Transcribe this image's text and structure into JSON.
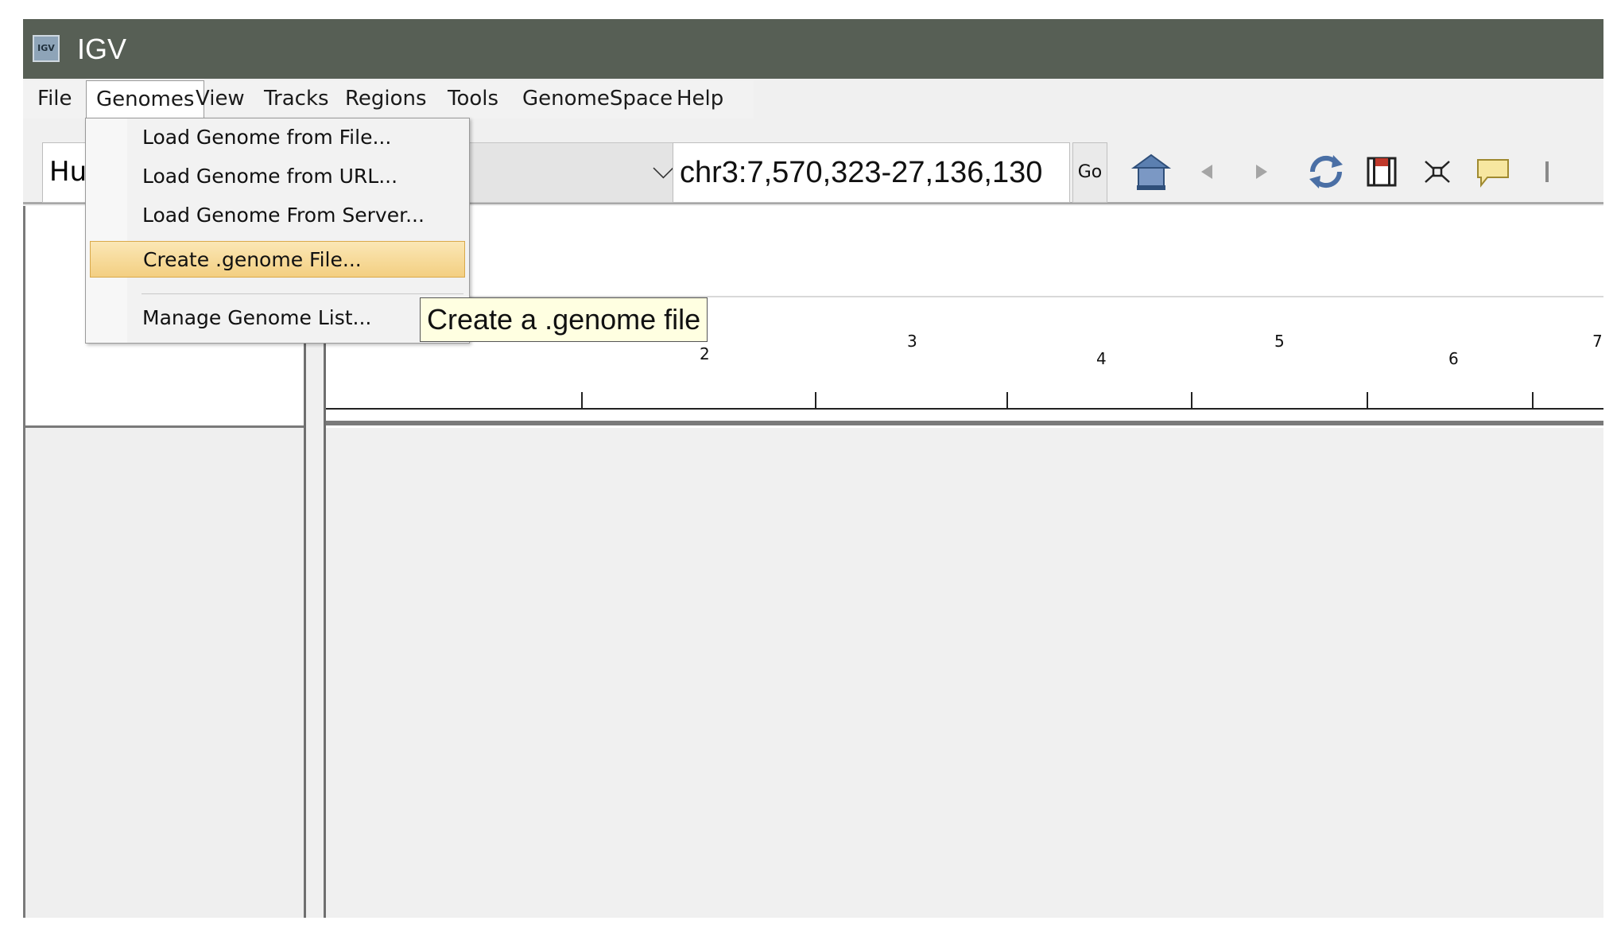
{
  "window": {
    "title": "IGV",
    "app_icon_text": "IGV"
  },
  "menubar": {
    "items": [
      {
        "label": "File"
      },
      {
        "label": "Genomes"
      },
      {
        "label": "View"
      },
      {
        "label": "Tracks"
      },
      {
        "label": "Regions"
      },
      {
        "label": "Tools"
      },
      {
        "label": "GenomeSpace"
      },
      {
        "label": "Help"
      }
    ],
    "active": "Genomes"
  },
  "toolbar": {
    "genome_value": "Hu",
    "chromosome_value": "",
    "locus_value": "chr3:7,570,323-27,136,130",
    "go_label": "Go",
    "icons": [
      "home-icon",
      "back-icon",
      "forward-icon",
      "refresh-icon",
      "region-icon",
      "resize-icon",
      "popup-info-icon",
      "ruler-icon"
    ]
  },
  "genomes_menu": {
    "items": [
      {
        "label": "Load Genome from File..."
      },
      {
        "label": "Load Genome from URL..."
      },
      {
        "label": "Load Genome From Server..."
      },
      {
        "label": "Create .genome File..."
      },
      {
        "label": "Manage Genome List..."
      }
    ],
    "highlighted": "Create .genome File..."
  },
  "tooltip": {
    "text": "Create a .genome file"
  },
  "ruler": {
    "labels": [
      "2",
      "3",
      "4",
      "5",
      "6",
      "7"
    ]
  },
  "colors": {
    "titlebar": "#575f55",
    "highlight": "#f3cf82",
    "tooltip_bg": "#ffffe1"
  }
}
